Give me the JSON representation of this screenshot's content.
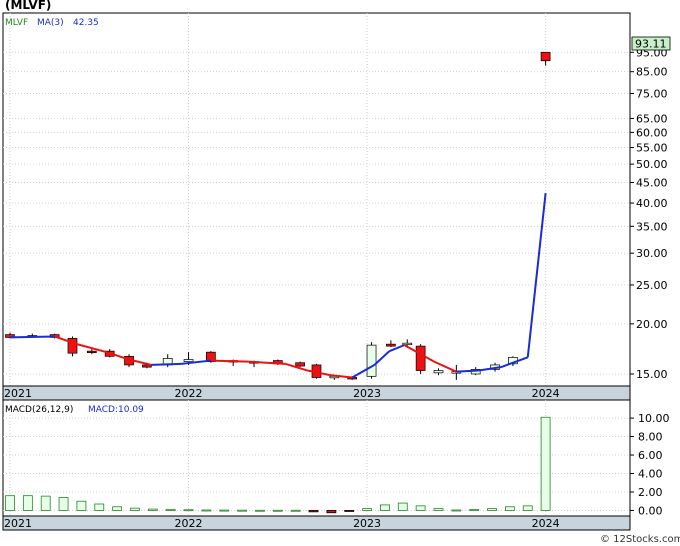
{
  "title": "(MLVF)",
  "watermark": "© 12Stocks.com",
  "colors": {
    "up_candle": "#e8ffe8",
    "down_candle": "#ee1111",
    "ma_up": "#1a2bd8",
    "ma_down": "#ee1111",
    "macd_bar": "#228822",
    "axis_band": "#c8d4dc",
    "last_price_box": "#c8f0c8"
  },
  "price_panel": {
    "legend_ticker": "MLVF",
    "legend_ma": "MA(3)",
    "legend_ma_value": "42.35",
    "last_price_label": "93.11",
    "yscale": "log",
    "ylim": [
      14.0,
      115
    ],
    "yticks": [
      {
        "v": 95,
        "label": "95.00"
      },
      {
        "v": 85,
        "label": "85.00"
      },
      {
        "v": 75,
        "label": "75.00"
      },
      {
        "v": 65,
        "label": "65.00"
      },
      {
        "v": 60,
        "label": "60.00"
      },
      {
        "v": 55,
        "label": "55.00"
      },
      {
        "v": 50,
        "label": "50.00"
      },
      {
        "v": 45,
        "label": "45.00"
      },
      {
        "v": 40,
        "label": "40.00"
      },
      {
        "v": 35,
        "label": "35.00"
      },
      {
        "v": 30,
        "label": "30.00"
      },
      {
        "v": 25,
        "label": "25.00"
      },
      {
        "v": 20,
        "label": "20.00"
      },
      {
        "v": 15,
        "label": "15.00"
      }
    ]
  },
  "x_axis": {
    "months_span": [
      0,
      41
    ],
    "year_ticks": [
      {
        "m": 0,
        "label": "2021"
      },
      {
        "m": 12,
        "label": "2022"
      },
      {
        "m": 24,
        "label": "2023"
      },
      {
        "m": 36,
        "label": "2024"
      }
    ]
  },
  "chart_data": [
    {
      "type": "candlestick",
      "x_unit": "months since Jan 2021",
      "candles": [
        {
          "m": 0,
          "o": 18.8,
          "h": 19.0,
          "l": 18.4,
          "c": 18.5
        },
        {
          "m": 1.5,
          "o": 18.7,
          "h": 18.9,
          "l": 18.5,
          "c": 18.6
        },
        {
          "m": 3,
          "o": 18.8,
          "h": 18.9,
          "l": 18.4,
          "c": 18.5
        },
        {
          "m": 4.2,
          "o": 18.4,
          "h": 18.6,
          "l": 16.6,
          "c": 16.9
        },
        {
          "m": 5.5,
          "o": 17.1,
          "h": 17.3,
          "l": 16.8,
          "c": 17.0
        },
        {
          "m": 6.7,
          "o": 17.1,
          "h": 17.3,
          "l": 16.5,
          "c": 16.6
        },
        {
          "m": 8,
          "o": 16.6,
          "h": 16.8,
          "l": 15.6,
          "c": 15.8
        },
        {
          "m": 9.2,
          "o": 15.8,
          "h": 16.0,
          "l": 15.5,
          "c": 15.6
        },
        {
          "m": 10.6,
          "o": 15.8,
          "h": 16.8,
          "l": 15.6,
          "c": 16.4
        },
        {
          "m": 12,
          "o": 16.1,
          "h": 17.0,
          "l": 15.8,
          "c": 16.3
        },
        {
          "m": 13.5,
          "o": 17.0,
          "h": 17.1,
          "l": 16.0,
          "c": 16.1
        },
        {
          "m": 15,
          "o": 16.2,
          "h": 16.3,
          "l": 15.7,
          "c": 16.1
        },
        {
          "m": 16.4,
          "o": 16.1,
          "h": 16.2,
          "l": 15.6,
          "c": 16.0
        },
        {
          "m": 18,
          "o": 16.2,
          "h": 16.3,
          "l": 15.8,
          "c": 15.9
        },
        {
          "m": 19.5,
          "o": 16.0,
          "h": 16.1,
          "l": 15.6,
          "c": 15.7
        },
        {
          "m": 20.6,
          "o": 15.8,
          "h": 15.9,
          "l": 14.6,
          "c": 14.7
        },
        {
          "m": 21.8,
          "o": 14.7,
          "h": 14.9,
          "l": 14.5,
          "c": 14.8
        },
        {
          "m": 23,
          "o": 14.7,
          "h": 14.8,
          "l": 14.5,
          "c": 14.6
        },
        {
          "m": 24.3,
          "o": 14.8,
          "h": 18.0,
          "l": 14.6,
          "c": 17.7
        },
        {
          "m": 25.6,
          "o": 17.8,
          "h": 18.2,
          "l": 17.5,
          "c": 17.6
        },
        {
          "m": 26.7,
          "o": 17.8,
          "h": 18.3,
          "l": 17.5,
          "c": 17.9
        },
        {
          "m": 27.6,
          "o": 17.6,
          "h": 17.8,
          "l": 15.0,
          "c": 15.3
        },
        {
          "m": 28.8,
          "o": 15.1,
          "h": 15.5,
          "l": 14.9,
          "c": 15.3
        },
        {
          "m": 30,
          "o": 15.2,
          "h": 15.8,
          "l": 14.5,
          "c": 15.2
        },
        {
          "m": 31.3,
          "o": 15.0,
          "h": 15.6,
          "l": 14.9,
          "c": 15.4
        },
        {
          "m": 32.6,
          "o": 15.4,
          "h": 16.0,
          "l": 15.2,
          "c": 15.8
        },
        {
          "m": 33.8,
          "o": 15.9,
          "h": 16.6,
          "l": 15.7,
          "c": 16.5
        },
        {
          "m": 36,
          "o": 95.0,
          "h": 95.2,
          "l": 88.0,
          "c": 90.5
        }
      ],
      "ma3": [
        {
          "m": 0,
          "v": 18.5
        },
        {
          "m": 3,
          "v": 18.6
        },
        {
          "m": 4.5,
          "v": 17.8
        },
        {
          "m": 6.5,
          "v": 17.0
        },
        {
          "m": 8,
          "v": 16.3
        },
        {
          "m": 9.5,
          "v": 15.8
        },
        {
          "m": 11.5,
          "v": 15.9
        },
        {
          "m": 13.5,
          "v": 16.2
        },
        {
          "m": 16,
          "v": 16.1
        },
        {
          "m": 18.5,
          "v": 15.9
        },
        {
          "m": 20,
          "v": 15.3
        },
        {
          "m": 21.5,
          "v": 14.9
        },
        {
          "m": 23,
          "v": 14.7
        },
        {
          "m": 24.5,
          "v": 15.8
        },
        {
          "m": 25.5,
          "v": 17.1
        },
        {
          "m": 26.5,
          "v": 17.7
        },
        {
          "m": 27.5,
          "v": 16.9
        },
        {
          "m": 28.5,
          "v": 16.1
        },
        {
          "m": 30,
          "v": 15.2
        },
        {
          "m": 31.5,
          "v": 15.3
        },
        {
          "m": 33,
          "v": 15.6
        },
        {
          "m": 34.8,
          "v": 16.5
        },
        {
          "m": 36,
          "v": 42.35
        }
      ]
    },
    {
      "type": "bar",
      "name": "MACD",
      "legend_label": "MACD(26,12,9)",
      "legend_value": "MACD:10.09",
      "ylim": [
        -0.6,
        11.2
      ],
      "yticks": [
        {
          "v": 10,
          "label": "10.00"
        },
        {
          "v": 8,
          "label": "8.00"
        },
        {
          "v": 6,
          "label": "6.00"
        },
        {
          "v": 4,
          "label": "4.00"
        },
        {
          "v": 2,
          "label": "2.00"
        },
        {
          "v": 0,
          "label": "0.00"
        }
      ],
      "bars": [
        {
          "m": 0,
          "v": 1.6
        },
        {
          "m": 1.2,
          "v": 1.6
        },
        {
          "m": 2.4,
          "v": 1.55
        },
        {
          "m": 3.6,
          "v": 1.4
        },
        {
          "m": 4.8,
          "v": 1.0
        },
        {
          "m": 6,
          "v": 0.7
        },
        {
          "m": 7.2,
          "v": 0.4
        },
        {
          "m": 8.4,
          "v": 0.25
        },
        {
          "m": 9.6,
          "v": 0.15
        },
        {
          "m": 10.8,
          "v": 0.12
        },
        {
          "m": 12,
          "v": 0.08
        },
        {
          "m": 13.2,
          "v": 0.05
        },
        {
          "m": 14.4,
          "v": 0.04
        },
        {
          "m": 15.6,
          "v": 0.03
        },
        {
          "m": 16.8,
          "v": 0.02
        },
        {
          "m": 18,
          "v": 0.02
        },
        {
          "m": 19.2,
          "v": 0.02
        },
        {
          "m": 20.4,
          "v": -0.15
        },
        {
          "m": 21.6,
          "v": -0.25
        },
        {
          "m": 22.8,
          "v": -0.1
        },
        {
          "m": 24,
          "v": 0.2
        },
        {
          "m": 25.2,
          "v": 0.6
        },
        {
          "m": 26.4,
          "v": 0.8
        },
        {
          "m": 27.6,
          "v": 0.5
        },
        {
          "m": 28.8,
          "v": 0.2
        },
        {
          "m": 30,
          "v": 0.05
        },
        {
          "m": 31.2,
          "v": 0.1
        },
        {
          "m": 32.4,
          "v": 0.2
        },
        {
          "m": 33.6,
          "v": 0.4
        },
        {
          "m": 34.8,
          "v": 0.5
        },
        {
          "m": 36,
          "v": 10.09
        }
      ]
    }
  ]
}
